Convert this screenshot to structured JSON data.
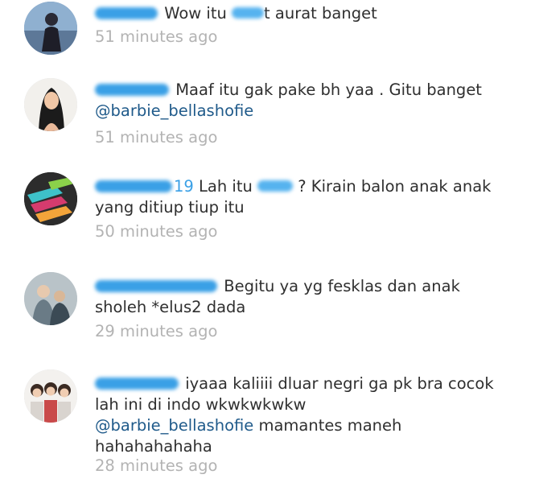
{
  "comments": [
    {
      "text_before": "Wow itu",
      "text_after": "t aurat banget",
      "time": "51 minutes ago"
    },
    {
      "text": "Maaf itu gak pake bh yaa . Gitu banget",
      "mention": "@barbie_bellashofie",
      "time": "51 minutes ago"
    },
    {
      "username_suffix": "19",
      "text_before": "Lah itu",
      "text_after": "? Kirain balon anak anak yang ditiup tiup itu",
      "time": "50 minutes ago"
    },
    {
      "text": "Begitu ya yg fesklas dan anak sholeh *elus2 dada",
      "time": "29 minutes ago"
    },
    {
      "text": "iyaaa kaliiii dluar negri ga pk bra cocok lah ini di indo wkwkwkwkw",
      "mention": "@barbie_bellashofie",
      "text_after": "mamantes maneh hahahahahaha",
      "time": "28 minutes ago"
    }
  ]
}
